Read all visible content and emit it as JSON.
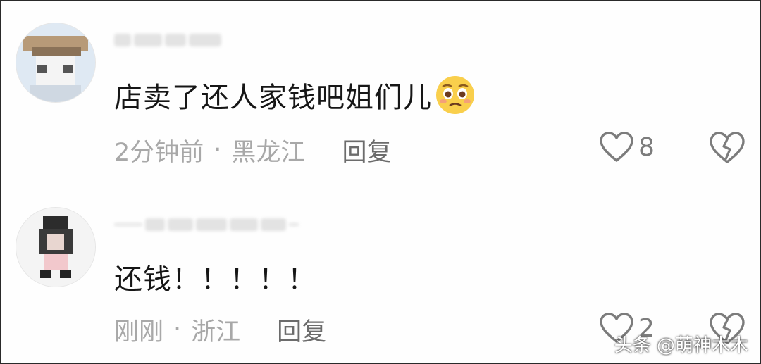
{
  "comments": [
    {
      "text": "店卖了还人家钱吧姐们儿",
      "emoji": "pleading-face-emoji",
      "time": "2分钟前",
      "separator": "·",
      "location": "黑龙江",
      "reply_label": "回复",
      "likes": "8"
    },
    {
      "text": "还钱！！！！！",
      "time": "刚刚",
      "separator": "·",
      "location": "浙江",
      "reply_label": "回复",
      "likes": "2"
    }
  ],
  "watermark": "头条 @萌神木木",
  "colors": {
    "text": "#161616",
    "meta": "#a8a8a8",
    "icon": "#7c7c7c"
  }
}
